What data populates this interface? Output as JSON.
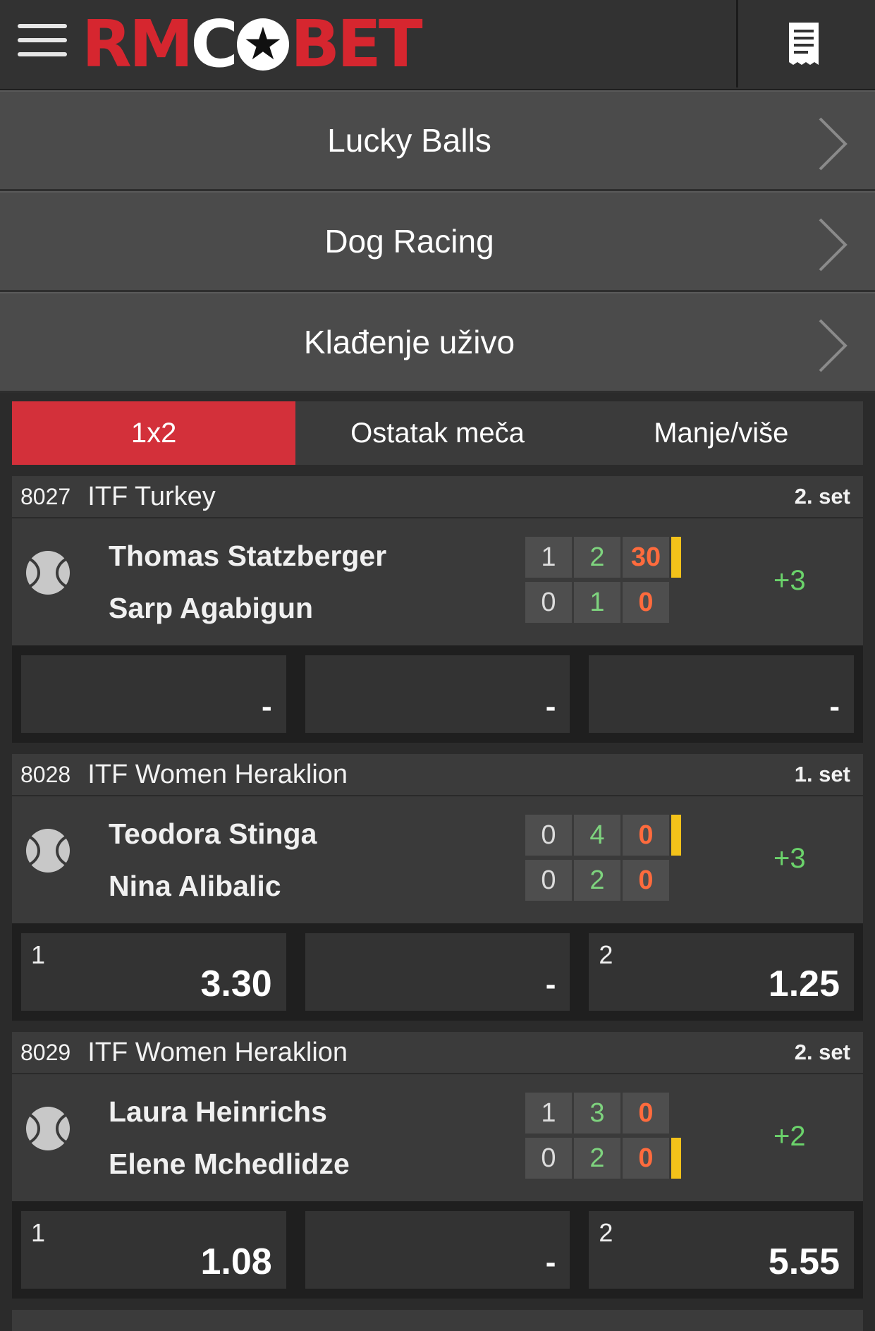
{
  "header": {
    "logo_red_1": "RM",
    "logo_white": "C",
    "logo_star": "★",
    "logo_red_2": "BET"
  },
  "nav": [
    {
      "label": "Lucky Balls"
    },
    {
      "label": "Dog Racing"
    },
    {
      "label": "Klađenje uživo"
    }
  ],
  "tabs": [
    {
      "label": "1x2",
      "active": true
    },
    {
      "label": "Ostatak meča",
      "active": false
    },
    {
      "label": "Manje/više",
      "active": false
    }
  ],
  "matches": [
    {
      "code": "8027",
      "league": "ITF Turkey",
      "set": "2. set",
      "team1": "Thomas Statzberger",
      "team2": "Sarp Agabigun",
      "score1": {
        "sets": "1",
        "games": "2",
        "points": "30"
      },
      "score2": {
        "sets": "0",
        "games": "1",
        "points": "0"
      },
      "serving": 1,
      "more": "+3",
      "odds": [
        {
          "label": "",
          "value": "-"
        },
        {
          "label": "",
          "value": "-"
        },
        {
          "label": "",
          "value": "-"
        }
      ]
    },
    {
      "code": "8028",
      "league": "ITF Women Heraklion",
      "set": "1. set",
      "team1": "Teodora Stinga",
      "team2": "Nina Alibalic",
      "score1": {
        "sets": "0",
        "games": "4",
        "points": "0"
      },
      "score2": {
        "sets": "0",
        "games": "2",
        "points": "0"
      },
      "serving": 1,
      "more": "+3",
      "odds": [
        {
          "label": "1",
          "value": "3.30"
        },
        {
          "label": "",
          "value": "-"
        },
        {
          "label": "2",
          "value": "1.25"
        }
      ]
    },
    {
      "code": "8029",
      "league": "ITF Women Heraklion",
      "set": "2. set",
      "team1": "Laura Heinrichs",
      "team2": "Elene Mchedlidze",
      "score1": {
        "sets": "1",
        "games": "3",
        "points": "0"
      },
      "score2": {
        "sets": "0",
        "games": "2",
        "points": "0"
      },
      "serving": 2,
      "more": "+2",
      "odds": [
        {
          "label": "1",
          "value": "1.08"
        },
        {
          "label": "",
          "value": "-"
        },
        {
          "label": "2",
          "value": "5.55"
        }
      ]
    }
  ],
  "colors": {
    "accent_red": "#d3303a",
    "games_green": "#7ed37e",
    "points_orange": "#ff6b3d",
    "serve_yellow": "#f3c21a"
  },
  "icons": {
    "menu": "hamburger-menu-icon",
    "betslip": "betslip-icon",
    "chevron": "chevron-right-icon",
    "sport": "tennis-ball-icon"
  }
}
